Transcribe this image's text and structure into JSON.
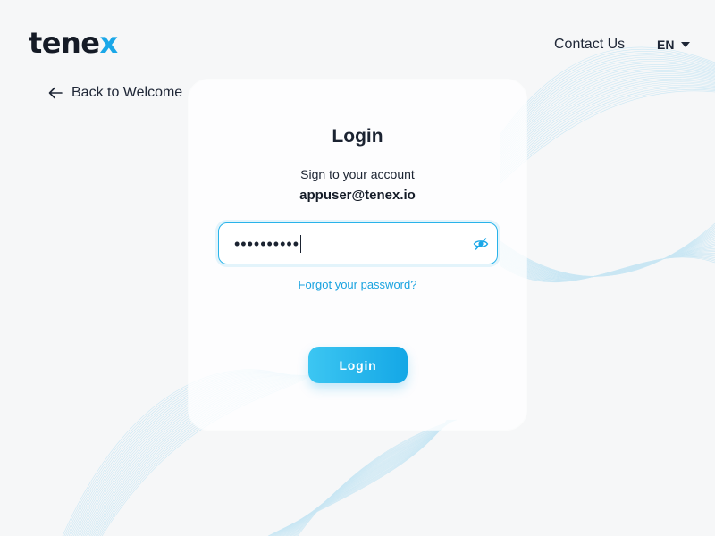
{
  "brand": {
    "logo_main": "tene",
    "logo_accent": "x",
    "accent_color": "#1aa7e8"
  },
  "header": {
    "contact_label": "Contact Us",
    "language": "EN"
  },
  "nav": {
    "back_label": "Back to Welcome"
  },
  "login": {
    "title": "Login",
    "subtitle": "Sign to your account",
    "email": "appuser@tenex.io",
    "password_masked": "••••••••••",
    "forgot_label": "Forgot your password?",
    "submit_label": "Login"
  },
  "icons": {
    "back": "arrow-left-icon",
    "language": "chevron-down-icon",
    "password_toggle": "eye-off-icon"
  }
}
